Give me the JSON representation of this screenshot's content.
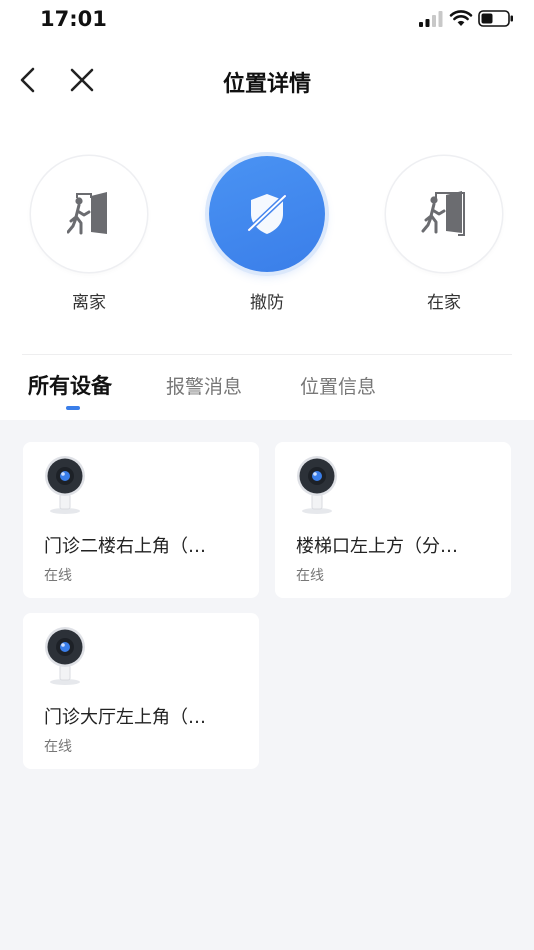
{
  "status_bar": {
    "time": "17:01"
  },
  "nav": {
    "title": "位置详情"
  },
  "modes": [
    {
      "label": "离家",
      "icon": "leave-home-icon",
      "active": false
    },
    {
      "label": "撤防",
      "icon": "disarm-shield-icon",
      "active": true
    },
    {
      "label": "在家",
      "icon": "at-home-icon",
      "active": false
    }
  ],
  "tabs": [
    {
      "label": "所有设备",
      "active": true
    },
    {
      "label": "报警消息",
      "active": false
    },
    {
      "label": "位置信息",
      "active": false
    }
  ],
  "devices": [
    {
      "name": "门诊二楼右上角（…",
      "status": "在线",
      "icon": "camera-icon"
    },
    {
      "name": "楼梯口左上方（分…",
      "status": "在线",
      "icon": "camera-icon"
    },
    {
      "name": "门诊大厅左上角（…",
      "status": "在线",
      "icon": "camera-icon"
    }
  ],
  "colors": {
    "accent": "#3a7ee9",
    "page_bg": "#f4f5f8",
    "card_bg": "#ffffff"
  }
}
